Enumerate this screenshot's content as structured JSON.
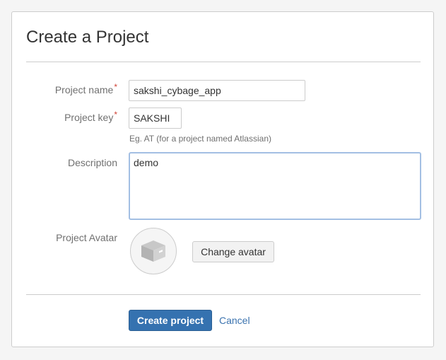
{
  "dialog": {
    "title": "Create a Project"
  },
  "form": {
    "project_name": {
      "label": "Project name",
      "required_marker": "*",
      "value": "sakshi_cybage_app"
    },
    "project_key": {
      "label": "Project key",
      "required_marker": "*",
      "value": "SAKSHI",
      "hint": "Eg. AT (for a project named Atlassian)"
    },
    "description": {
      "label": "Description",
      "value": "demo"
    },
    "avatar": {
      "label": "Project Avatar",
      "icon": "box-icon",
      "change_label": "Change avatar"
    }
  },
  "actions": {
    "submit_label": "Create project",
    "cancel_label": "Cancel"
  },
  "colors": {
    "primary": "#3572b0",
    "link": "#3b73af",
    "required": "#d04437",
    "focus_border": "#a3bfe3"
  }
}
